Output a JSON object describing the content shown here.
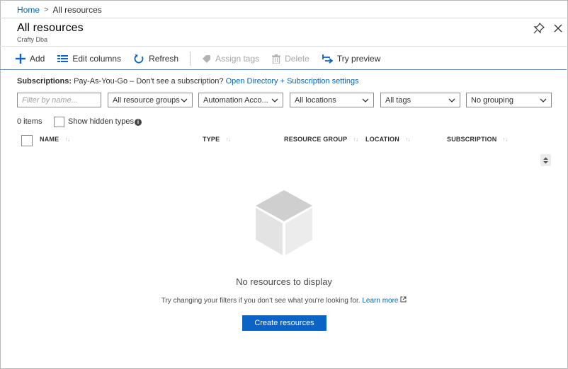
{
  "breadcrumb": {
    "home": "Home",
    "separator": ">",
    "current": "All resources"
  },
  "header": {
    "title": "All resources",
    "subtitle": "Crafty Dba"
  },
  "toolbar": {
    "add": "Add",
    "edit_columns": "Edit columns",
    "refresh": "Refresh",
    "assign_tags": "Assign tags",
    "delete": "Delete",
    "try_preview": "Try preview"
  },
  "subscriptions": {
    "label": "Subscriptions:",
    "text": "Pay-As-You-Go – Don't see a subscription?",
    "link": "Open Directory + Subscription settings"
  },
  "filters": {
    "name_placeholder": "Filter by name...",
    "resource_groups": "All resource groups",
    "resource_type": "Automation Acco...",
    "locations": "All locations",
    "tags": "All tags",
    "grouping": "No grouping"
  },
  "list": {
    "count": "0 items",
    "show_hidden": "Show hidden types",
    "columns": [
      "NAME",
      "TYPE",
      "RESOURCE GROUP",
      "LOCATION",
      "SUBSCRIPTION"
    ],
    "sort_glyph": "↑↓"
  },
  "empty_state": {
    "title": "No resources to display",
    "description": "Try changing your filters if you don't see what you're looking for.",
    "learn_more": "Learn more",
    "create_button": "Create resources"
  },
  "colors": {
    "accent": "#0066b8",
    "primary_button": "#0b63c5",
    "disabled": "#a6a6a6"
  }
}
